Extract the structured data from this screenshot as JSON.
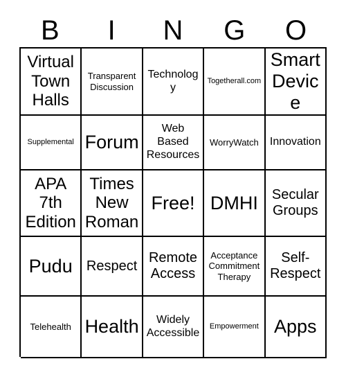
{
  "card": {
    "header_letters": [
      "B",
      "I",
      "N",
      "G",
      "O"
    ],
    "rows": [
      [
        {
          "text": "Virtual Town Halls",
          "size": "lg"
        },
        {
          "text": "Transparent Discussion",
          "size": "xs"
        },
        {
          "text": "Technology",
          "size": "sm"
        },
        {
          "text": "Togetherall.com",
          "size": "xxs"
        },
        {
          "text": "Smart Device",
          "size": "xl"
        }
      ],
      [
        {
          "text": "Supplemental",
          "size": "xxs"
        },
        {
          "text": "Forum",
          "size": "xl"
        },
        {
          "text": "Web Based Resources",
          "size": "sm"
        },
        {
          "text": "WorryWatch",
          "size": "xs"
        },
        {
          "text": "Innovation",
          "size": "sm"
        }
      ],
      [
        {
          "text": "APA 7th Edition",
          "size": "lg"
        },
        {
          "text": "Times New Roman",
          "size": "lg"
        },
        {
          "text": "Free!",
          "size": "xl"
        },
        {
          "text": "DMHI",
          "size": "xl"
        },
        {
          "text": "Secular Groups",
          "size": "md"
        }
      ],
      [
        {
          "text": "Pudu",
          "size": "xl"
        },
        {
          "text": "Respect",
          "size": "md"
        },
        {
          "text": "Remote Access",
          "size": "md"
        },
        {
          "text": "Acceptance Commitment Therapy",
          "size": "xs"
        },
        {
          "text": "Self-Respect",
          "size": "md"
        }
      ],
      [
        {
          "text": "Telehealth",
          "size": "xs"
        },
        {
          "text": "Health",
          "size": "xl"
        },
        {
          "text": "Widely Accessible",
          "size": "sm"
        },
        {
          "text": "Empowerment",
          "size": "xxs"
        },
        {
          "text": "Apps",
          "size": "xl"
        }
      ]
    ],
    "free_space_label": "Free!",
    "colors": {
      "background": "#ffffff",
      "grid_line": "#000000",
      "text": "#000000"
    }
  }
}
